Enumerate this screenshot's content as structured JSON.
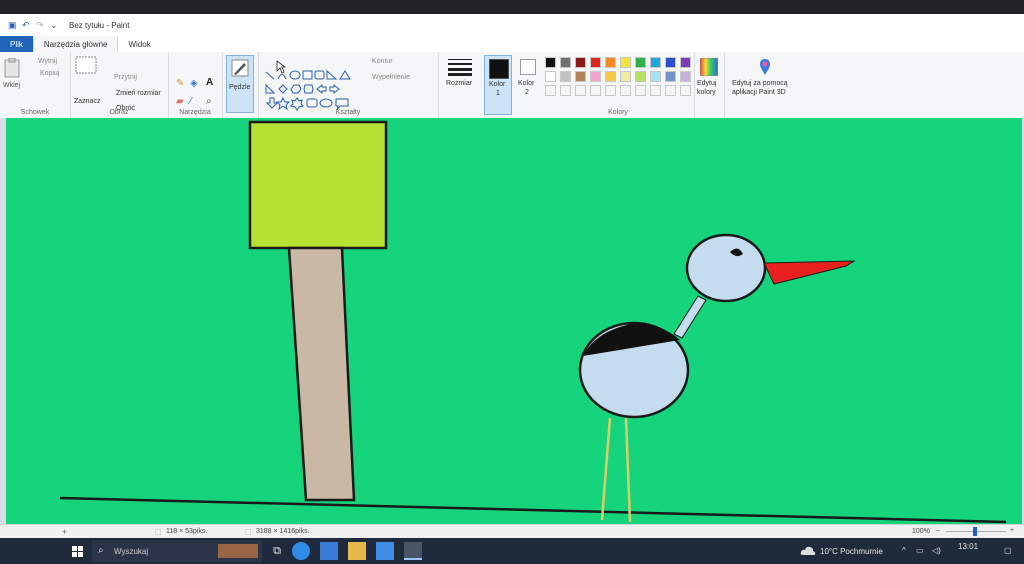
{
  "window": {
    "title": "Bez tytułu - Paint"
  },
  "menu": {
    "file": "Plik",
    "home": "Narzędzia główne",
    "view": "Widok"
  },
  "clipboard": {
    "paste": "Wklej",
    "cut": "Wytnij",
    "copy": "Kopiuj",
    "label": "Schowek"
  },
  "image": {
    "select": "Zaznacz",
    "crop": "Przytnij",
    "resize": "Zmień rozmiar",
    "rotate": "Obróć",
    "label": "Obraz"
  },
  "tools": {
    "label": "Narzędzia"
  },
  "brushes": {
    "label": "Pędzle"
  },
  "shapes": {
    "outline": "Kontur",
    "fill": "Wypełnienie",
    "label": "Kształty"
  },
  "size": {
    "label": "Rozmiar"
  },
  "color1": {
    "label_top": "Kolor",
    "label_bottom": "1",
    "value": "#111111"
  },
  "color2": {
    "label_top": "Kolor",
    "label_bottom": "2",
    "value": "#ffffff"
  },
  "colors": {
    "label": "Kolory",
    "row1": [
      "#111111",
      "#6f6f6f",
      "#8b1a1a",
      "#e2231a",
      "#f08a24",
      "#f2e23a",
      "#2fae4a",
      "#22a3d9",
      "#2f4fc6",
      "#7a3fb8"
    ],
    "row2": [
      "#ffffff",
      "#c3c3c3",
      "#b5835a",
      "#f3a6c8",
      "#f7c94b",
      "#eeec9d",
      "#b5e061",
      "#a4e3ef",
      "#7492c9",
      "#c6b1dc"
    ],
    "row3": [
      "#f4f4f4",
      "#f4f4f4",
      "#f4f4f4",
      "#f4f4f4",
      "#f4f4f4",
      "#f4f4f4",
      "#f4f4f4",
      "#f4f4f4",
      "#f4f4f4",
      "#f4f4f4"
    ]
  },
  "edit_colors": {
    "label1": "Edytuj",
    "label2": "kolory"
  },
  "paint3d": {
    "label1": "Edytuj za pomocą",
    "label2": "aplikacji Paint 3D"
  },
  "status": {
    "selection": "118 × 53piks.",
    "image_size": "3188 × 1416piks.",
    "zoom": "100%"
  },
  "taskbar": {
    "search_placeholder": "Wyszukaj",
    "weather": "10°C  Pochmurnie",
    "time": "13:01"
  },
  "palette": {
    "canvas_bg": "#15d47c",
    "tree_top": "#b6e133",
    "trunk": "#c9b8a4",
    "bird_body": "#c5dcef",
    "beak": "#e8201f",
    "legs": "#d8cf6a"
  }
}
